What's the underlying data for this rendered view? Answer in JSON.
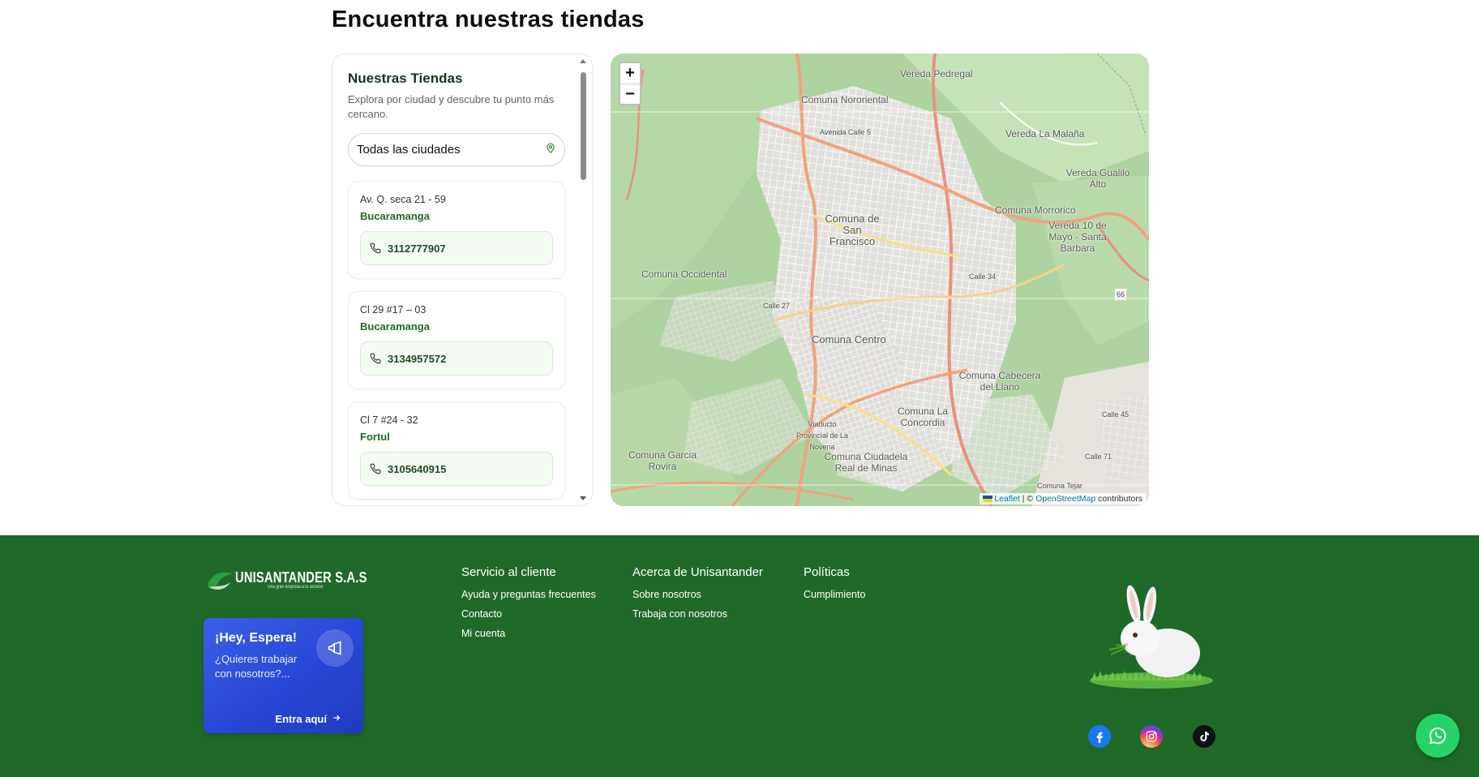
{
  "section": {
    "title": "Encuentra nuestras tiendas"
  },
  "stores": {
    "title": "Nuestras Tiendas",
    "subtitle": "Explora por ciudad y descubre tu punto más cercano.",
    "city_filter": "Todas las ciudades",
    "items": [
      {
        "address": "Av. Q. seca 21 - 59",
        "city": "Bucaramanga",
        "phone": "3112777907"
      },
      {
        "address": "Cl 29 #17 – 03",
        "city": "Bucaramanga",
        "phone": "3134957572"
      },
      {
        "address": "Cl 7 #24 - 32",
        "city": "Fortul",
        "phone": "3105640915"
      }
    ]
  },
  "map": {
    "zoom_in": "+",
    "zoom_out": "−",
    "labels": {
      "vereda_pedregal": "Vereda Pedregal",
      "comuna_nororiental": "Comuna Nororiental",
      "vereda_la_malana": "Vereda La Malaña",
      "vereda_gualilo": "Vereda Gualilo Alto",
      "comuna_morrorico": "Comuna Morrorico",
      "vereda_10_mayo": "Vereda 10 de Mayo - Santa Barbara",
      "comuna_san_francisco": "Comuna de San Francisco",
      "comuna_occidental": "Comuna Occidental",
      "comuna_centro": "Comuna Centro",
      "comuna_cabecera": "Comuna Cabecera del Llano",
      "comuna_la_concordia": "Comuna La Concordia",
      "viaducto": "Viaducto Provincial de La Novena",
      "comuna_garcia_rovira": "Comuna Garcia Rovira",
      "comuna_ciudadela": "Comuna Ciudadela Real de Minas",
      "comuna_tejar": "Comuna Tejar",
      "calle_27": "Calle 27",
      "calle_34": "Calle 34",
      "calle_45": "Calle 45",
      "calle_71": "Calle 71",
      "avenida_calle_5": "Avenida Calle 5",
      "route_66": "66"
    },
    "attribution_leaflet": "Leaflet",
    "attribution_sep": " | © ",
    "attribution_osm": "OpenStreetMap",
    "attribution_suffix": " contributors"
  },
  "footer": {
    "logo_name": "UNISANTANDER S.A.S",
    "logo_tagline": "Una gran empresa a tu servicio",
    "promo": {
      "title": "¡Hey, Espera!",
      "text": "¿Quieres trabajar con nosotros?...",
      "link": "Entra aquí"
    },
    "columns": [
      {
        "title": "Servicio al cliente",
        "links": [
          "Ayuda y preguntas frecuentes",
          "Contacto",
          "Mi cuenta"
        ]
      },
      {
        "title": "Acerca de Unisantander",
        "links": [
          "Sobre nosotros",
          "Trabaja con nosotros"
        ]
      },
      {
        "title": "Políticas",
        "links": [
          "Cumplimiento"
        ]
      }
    ],
    "social": [
      "facebook-icon",
      "instagram-icon",
      "tiktok-icon"
    ]
  },
  "colors": {
    "footer_bg": "#1f6a29",
    "accent_green": "#1f6b26",
    "promo_blue": "#2748d6",
    "whatsapp": "#25d366"
  }
}
